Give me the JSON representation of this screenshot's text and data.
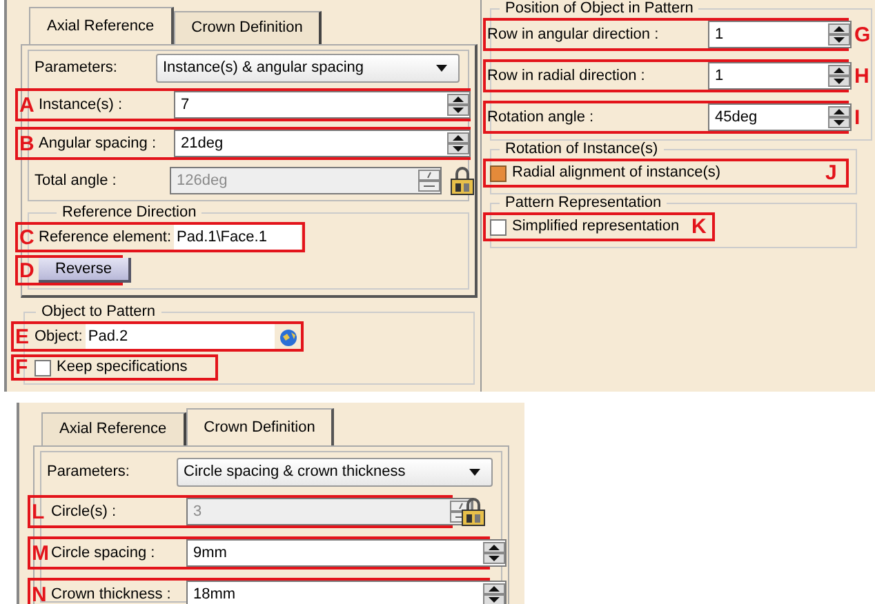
{
  "axial_panel": {
    "tabs": [
      {
        "label": "Axial Reference",
        "selected": true
      },
      {
        "label": "Crown Definition",
        "selected": false
      }
    ],
    "parameters_label": "Parameters:",
    "parameters_value": "Instance(s) & angular spacing",
    "fields": [
      {
        "marker": "A",
        "label": "Instance(s) :",
        "value": "7",
        "disabled": false
      },
      {
        "marker": "B",
        "label": "Angular spacing :",
        "value": "21deg",
        "disabled": false
      },
      {
        "label": "Total angle :",
        "value": "126deg",
        "disabled": true
      }
    ],
    "reference_direction": {
      "title": "Reference Direction",
      "marker": "C",
      "label": "Reference element:",
      "value": "Pad.1\\Face.1"
    },
    "reverse_button": {
      "marker": "D",
      "label": "Reverse"
    }
  },
  "object_to_pattern": {
    "title": "Object to Pattern",
    "marker": "E",
    "label": "Object:",
    "value": "Pad.2"
  },
  "keep_specifications": {
    "marker": "F",
    "label": "Keep specifications",
    "checked": false
  },
  "position": {
    "title": "Position of Object in Pattern",
    "rows": [
      {
        "marker": "G",
        "label": "Row in angular direction :",
        "value": "1"
      },
      {
        "marker": "H",
        "label": "Row in radial direction :",
        "value": "1"
      },
      {
        "marker": "I",
        "label": "Rotation angle :",
        "value": "45deg"
      }
    ]
  },
  "rotation": {
    "title": "Rotation of Instance(s)",
    "marker": "J",
    "label": "Radial alignment of instance(s)",
    "checked": true
  },
  "representation": {
    "title": "Pattern Representation",
    "marker": "K",
    "label": "Simplified representation",
    "checked": false
  },
  "crown_panel": {
    "tabs": [
      {
        "label": "Axial Reference",
        "selected": false
      },
      {
        "label": "Crown Definition",
        "selected": true
      }
    ],
    "parameters_label": "Parameters:",
    "parameters_value": "Circle spacing & crown thickness",
    "fields": [
      {
        "marker": "L",
        "label": "Circle(s) :",
        "value": "3",
        "disabled": true
      },
      {
        "marker": "M",
        "label": "Circle  spacing :",
        "value": "9mm",
        "disabled": false
      },
      {
        "marker": "N",
        "label": "Crown thickness :",
        "value": "18mm",
        "disabled": false
      }
    ]
  }
}
